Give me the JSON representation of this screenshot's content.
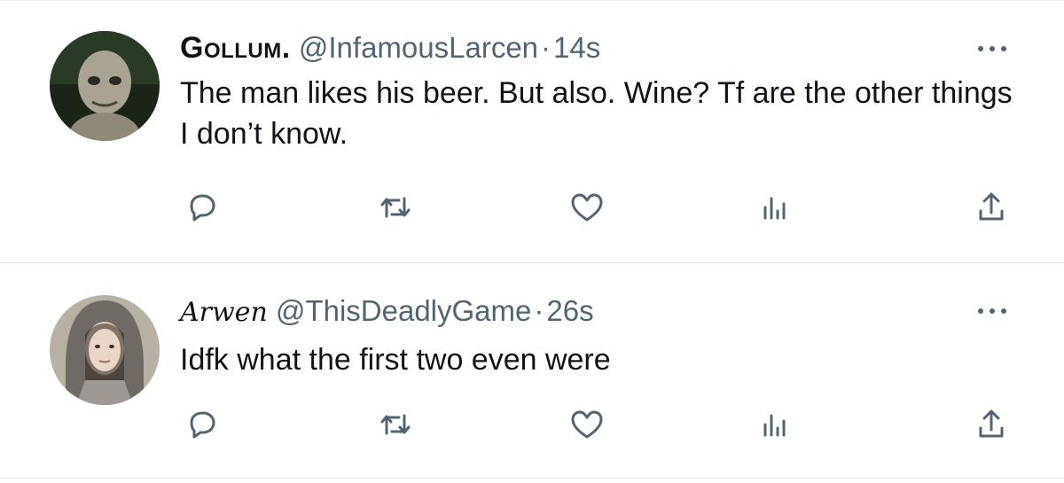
{
  "tweets": [
    {
      "display_name": "Gollum.",
      "handle": "@InfamousLarcen",
      "separator": "·",
      "time": "14s",
      "text": "The man likes his beer. But also. Wine? Tf are the other things I don’t know.",
      "avatar": "gollum-avatar",
      "actions": [
        "reply-icon",
        "retweet-icon",
        "like-icon",
        "views-icon",
        "share-icon"
      ]
    },
    {
      "display_name": "Arwen",
      "handle": "@ThisDeadlyGame",
      "separator": "·",
      "time": "26s",
      "text": "Idfk what the first two even were",
      "avatar": "arwen-avatar",
      "actions": [
        "reply-icon",
        "retweet-icon",
        "like-icon",
        "views-icon",
        "share-icon"
      ]
    }
  ],
  "colors": {
    "text": "#0f1419",
    "secondary": "#536471",
    "divider": "#e5e8ea"
  }
}
